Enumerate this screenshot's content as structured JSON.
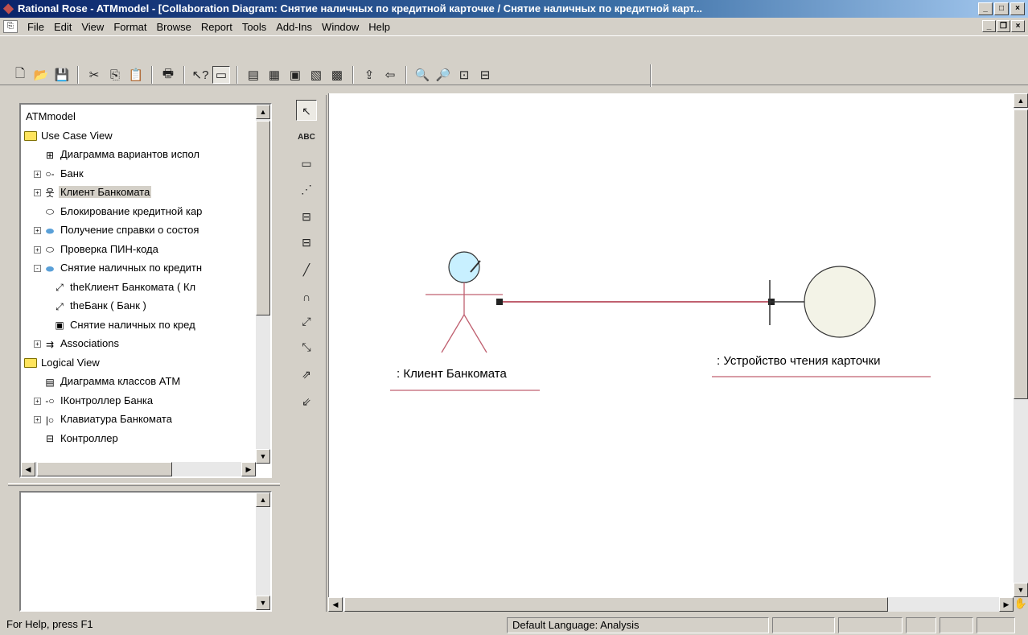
{
  "window": {
    "title": "Rational Rose - ATMmodel - [Collaboration Diagram: Снятие наличных по кредитной карточке / Снятие наличных по кредитной карт..."
  },
  "menu": [
    "File",
    "Edit",
    "View",
    "Format",
    "Browse",
    "Report",
    "Tools",
    "Add-Ins",
    "Window",
    "Help"
  ],
  "browser": {
    "items": [
      {
        "label": "ATMmodel",
        "icon": "model-icon",
        "indent": 0
      },
      {
        "label": "Use Case View",
        "icon": "folder-icon",
        "indent": 0
      },
      {
        "label": "Диаграмма вариантов испол",
        "icon": "usecase-diagram-icon",
        "indent": 2
      },
      {
        "label": "Банк",
        "icon": "interface-actor-icon",
        "indent": 1,
        "expand": "+"
      },
      {
        "label": "Клиент Банкомата",
        "icon": "actor-icon",
        "indent": 1,
        "expand": "+",
        "selected": true
      },
      {
        "label": "Блокирование кредитной кар",
        "icon": "usecase-icon",
        "indent": 2
      },
      {
        "label": "Получение справки о состоя",
        "icon": "usecase-filled-icon",
        "indent": 1,
        "expand": "+"
      },
      {
        "label": "Проверка ПИН-кода",
        "icon": "usecase-icon",
        "indent": 1,
        "expand": "+"
      },
      {
        "label": "Снятие наличных по кредитн",
        "icon": "usecase-filled-icon",
        "indent": 1,
        "expand": "-"
      },
      {
        "label": "theКлиент Банкомата ( Кл",
        "icon": "association-role-icon",
        "indent": 3
      },
      {
        "label": "theБанк ( Банк )",
        "icon": "association-role-icon",
        "indent": 3
      },
      {
        "label": "Снятие наличных по кред",
        "icon": "collaboration-diagram-icon",
        "indent": 3
      },
      {
        "label": "Associations",
        "icon": "associations-icon",
        "indent": 1,
        "expand": "+"
      },
      {
        "label": "Logical View",
        "icon": "folder-icon",
        "indent": 0
      },
      {
        "label": "Диаграмма классов ATM",
        "icon": "class-diagram-icon",
        "indent": 2
      },
      {
        "label": "IКонтроллер Банка",
        "icon": "interface-icon",
        "indent": 1,
        "expand": "+"
      },
      {
        "label": "Клавиатура Банкомата",
        "icon": "boundary-class-icon",
        "indent": 1,
        "expand": "+"
      },
      {
        "label": "Контроллер",
        "icon": "class-icon",
        "indent": 2
      }
    ]
  },
  "palette": [
    "pointer-tool",
    "text-tool",
    "note-tool",
    "anchor-tool",
    "object-tool",
    "class-instance-tool",
    "link-tool",
    "self-link-tool",
    "message-tool",
    "reverse-message-tool",
    "data-flow-tool",
    "reverse-data-flow-tool"
  ],
  "palette_text": {
    "abc": "ABC"
  },
  "diagram": {
    "actor_label": ": Клиент Банкомата",
    "boundary_label": ": Устройство чтения карточки"
  },
  "status": {
    "help": "For Help, press F1",
    "language": "Default Language: Analysis"
  },
  "colors": {
    "link": "#c06070",
    "actor_fill": "#c8f0ff",
    "boundary_fill": "#f3f3e7",
    "title_start": "#0a246a",
    "title_end": "#a6caf0"
  }
}
